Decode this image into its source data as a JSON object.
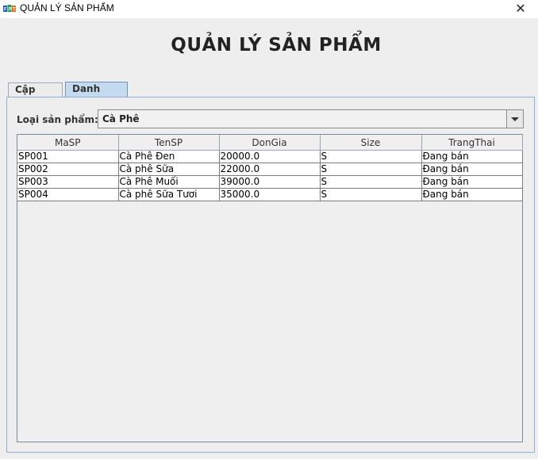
{
  "window": {
    "title": "QUẢN LÝ SẢN PHẨM",
    "close_glyph": "✕",
    "icon": "fpt-logo-icon"
  },
  "heading": "QUẢN LÝ SẢN PHẨM",
  "tabs": [
    {
      "label": "Cập nhật",
      "selected": false
    },
    {
      "label": "Danh sách",
      "selected": true
    }
  ],
  "filter": {
    "label": "Loại sản phẩm:",
    "selected": "Cà Phê"
  },
  "table": {
    "columns": [
      "MaSP",
      "TenSP",
      "DonGia",
      "Size",
      "TrangThai"
    ],
    "rows": [
      [
        "SP001",
        "Cà Phê Đen",
        "20000.0",
        "S",
        "Đang bán"
      ],
      [
        "SP002",
        "Cà phê Sữa",
        "22000.0",
        "S",
        "Đang bán"
      ],
      [
        "SP003",
        "Cà Phê Muối",
        "39000.0",
        "S",
        "Đang bán"
      ],
      [
        "SP004",
        "Cà phê Sữa Tươi",
        "35000.0",
        "S",
        "Đang bán"
      ]
    ]
  },
  "colors": {
    "accent_tab": "#c4daf1",
    "panel_border": "#8fb0d4"
  }
}
